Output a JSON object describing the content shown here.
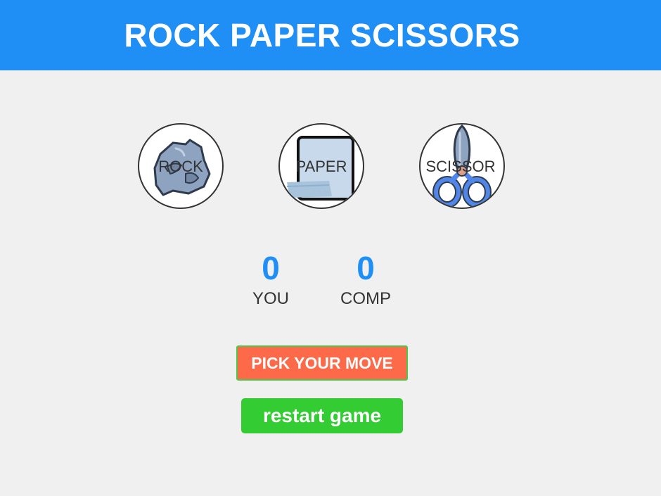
{
  "header": {
    "title": "ROCK PAPER SCISSORS",
    "background": "#1f8ef5"
  },
  "choices": [
    {
      "label": "ROCK",
      "icon": "rock-icon"
    },
    {
      "label": "PAPER",
      "icon": "paper-icon"
    },
    {
      "label": "SCISSOR",
      "icon": "scissors-icon"
    }
  ],
  "scoreboard": {
    "user": {
      "value": "0",
      "label": "YOU"
    },
    "computer": {
      "value": "0",
      "label": "COMP"
    }
  },
  "message": {
    "text": "PICK YOUR MOVE",
    "background": "#fc6a4a"
  },
  "restart": {
    "label": "restart game",
    "background": "#33cc33"
  },
  "colors": {
    "accent": "#1f8ef5",
    "page_background": "#f0f0f0"
  }
}
